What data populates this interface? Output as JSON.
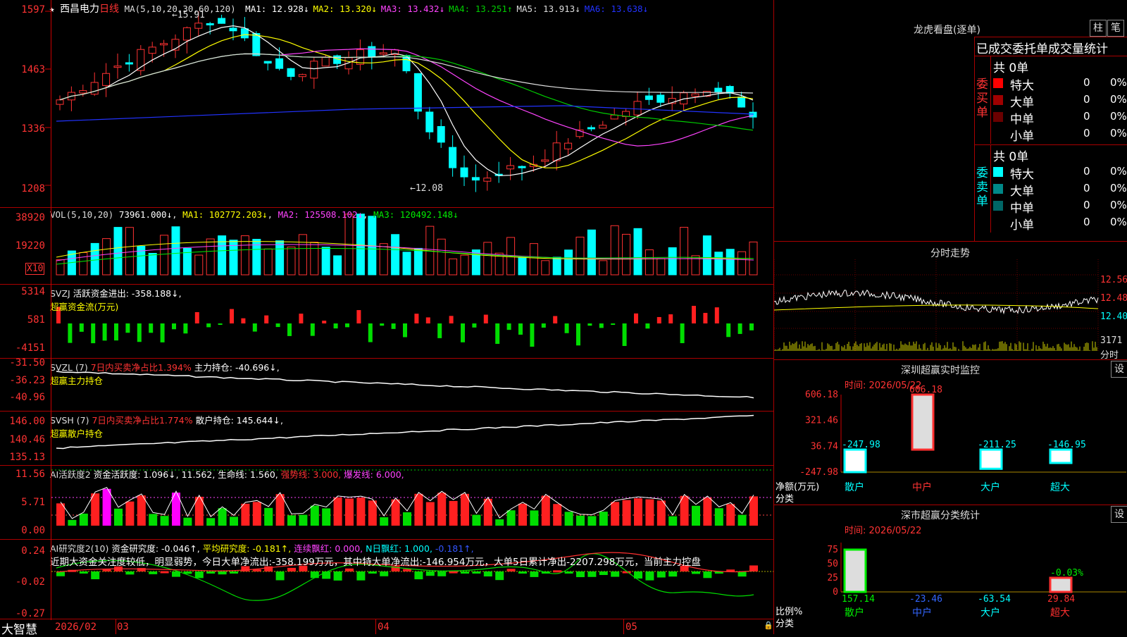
{
  "main": {
    "title": "西昌电力",
    "period": "日线",
    "ma_header": "MA(5,10,20,30,60,120)",
    "ma_values": [
      {
        "label": "MA1: 12.928↓",
        "color": "#ffffff"
      },
      {
        "label": "MA2: 13.320↓",
        "color": "#ffff00"
      },
      {
        "label": "MA3: 13.432↓",
        "color": "#ff44ff"
      },
      {
        "label": "MA4: 13.251↑",
        "color": "#00cc00"
      },
      {
        "label": "MA5: 13.913↓",
        "color": "#dddddd"
      },
      {
        "label": "MA6: 13.638↓",
        "color": "#2233ff"
      }
    ],
    "y_labels": [
      "1597",
      "1463",
      "1336",
      "1208"
    ],
    "high_note": "15.91",
    "low_note": "12.08"
  },
  "vol": {
    "header": "VOL(5,10,20)",
    "value": "73961.000↓",
    "ma1": "MA1: 102772.203↓",
    "ma2": "MA2: 125508.102↓",
    "ma3": "MA3: 120492.148↓",
    "y_labels": [
      "38920",
      "19220"
    ],
    "unit": "X10"
  },
  "svzj": {
    "header": "SVZJ",
    "line1": "活跃资金进出: -358.188↓,",
    "line2": "超赢资金流(万元)",
    "y_labels": [
      "5314",
      "581",
      "-4151"
    ]
  },
  "svzl": {
    "header": "SVZL (7)",
    "seg1": "7日内买卖净占比1.394%",
    "seg2": "主力持仓: -40.696↓,",
    "line2": "超赢主力持仓",
    "y_labels": [
      "-31.50",
      "-36.23",
      "-40.96"
    ]
  },
  "svsh": {
    "header": "SVSH (7)",
    "seg1": "7日内买卖净占比1.774%",
    "seg2": "散户持仓: 145.644↓,",
    "line2": "超赢散户持仓",
    "y_labels": [
      "146.00",
      "140.46",
      "135.13"
    ]
  },
  "ai1": {
    "header": "AI活跃度2",
    "seg1": "资金活跃度: 1.096↓,",
    "seg2": "11.562,",
    "seg3": "生命线: 1.560,",
    "seg4": "强势线: 3.000,",
    "seg5": "爆发线: 6.000,",
    "y_labels": [
      "11.56",
      "5.71",
      "0.00"
    ]
  },
  "ai2": {
    "header": "AI研究度2(10)",
    "seg1": "资金研究度: -0.046↑,",
    "seg2": "平均研究度: -0.181↑,",
    "seg3": "连续飘红: 0.000,",
    "seg4": "N日飘红: 1.000,",
    "seg5": "-0.181↑,",
    "comment": "近期大资金关注度较低，明显弱势，今日大单净流出:-358.199万元，其中特大单净流出:-146.954万元，大单5日累计净出-2207.298万元，当前主力控盘",
    "y_labels": [
      "0.24",
      "-0.02",
      "-0.27"
    ]
  },
  "bottom": {
    "brand": "大智慧",
    "dates": [
      "2026/02",
      "03",
      "04",
      "05"
    ]
  },
  "right": {
    "lhkp_title": "龙虎看盘(逐单)",
    "btn_zhu": "柱",
    "btn_bi": "笔",
    "order_header": "已成交委托单成交量统计",
    "buy": {
      "label": "委买单",
      "total": "共 0单",
      "rows": [
        {
          "name": "特大",
          "count": "0",
          "pct": "0%",
          "color": "#ff0000"
        },
        {
          "name": "大单",
          "count": "0",
          "pct": "0%",
          "color": "#a00000"
        },
        {
          "name": "中单",
          "count": "0",
          "pct": "0%",
          "color": "#6a0000"
        },
        {
          "name": "小单",
          "count": "0",
          "pct": "0%",
          "color": "#000000"
        }
      ]
    },
    "sell": {
      "label": "委卖单",
      "total": "共 0单",
      "rows": [
        {
          "name": "特大",
          "count": "0",
          "pct": "0%",
          "color": "#00ffff"
        },
        {
          "name": "大单",
          "count": "0",
          "pct": "0%",
          "color": "#008888"
        },
        {
          "name": "中单",
          "count": "0",
          "pct": "0%",
          "color": "#006666"
        },
        {
          "name": "小单",
          "count": "0",
          "pct": "0%",
          "color": "#000000"
        }
      ]
    },
    "fenshi_title": "分时走势",
    "fenshi_y": [
      "12.56",
      "12.48",
      "12.40",
      "3171"
    ],
    "fenshi_unit": "分时",
    "szcy": {
      "title": "深圳超赢实时监控",
      "btn": "设",
      "time": "时间: 2026/05/22",
      "y_labels": [
        "606.18",
        "321.46",
        "36.74",
        "-247.98"
      ],
      "y_unit": "净额(万元)",
      "x_unit": "分类",
      "cats": [
        "散户",
        "中户",
        "大户",
        "超大"
      ],
      "values": [
        -247.98,
        606.18,
        -211.25,
        -146.95
      ],
      "value_labels": [
        "-247.98",
        "606.18",
        "-211.25",
        "-146.95"
      ]
    },
    "scfl": {
      "title": "深市超赢分类统计",
      "btn": "设",
      "time": "时间: 2026/05/22",
      "y_labels": [
        "75",
        "50",
        "25",
        "0"
      ],
      "y_unit": "比例%",
      "x_unit": "分类",
      "cats": [
        "散户",
        "中户",
        "大户",
        "超大"
      ],
      "values": [
        157.14,
        -23.46,
        -63.54,
        29.84
      ],
      "value_labels": [
        "157.14",
        "-23.46",
        "-63.54",
        "29.84"
      ],
      "extra_label": "-0.03%"
    }
  }
}
